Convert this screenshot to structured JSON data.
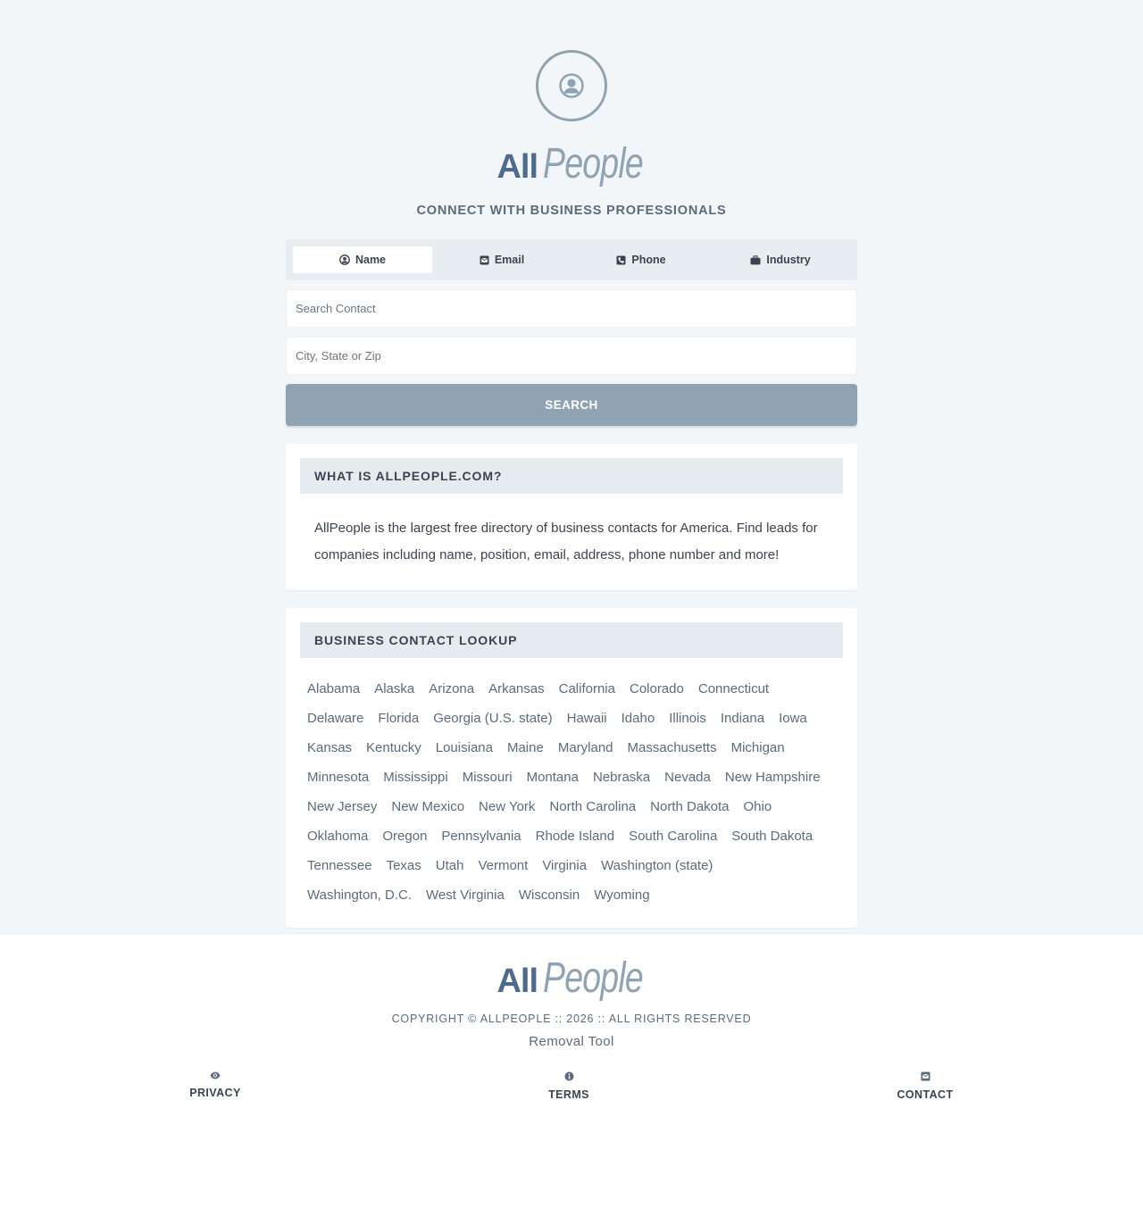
{
  "brand": {
    "logo_all": "All",
    "logo_people": "People"
  },
  "tagline": "CONNECT WITH BUSINESS PROFESSIONALS",
  "tabs": [
    {
      "label": "Name",
      "icon": "user-circle-icon",
      "active": true
    },
    {
      "label": "Email",
      "icon": "envelope-icon",
      "active": false
    },
    {
      "label": "Phone",
      "icon": "phone-icon",
      "active": false
    },
    {
      "label": "Industry",
      "icon": "briefcase-icon",
      "active": false
    }
  ],
  "search": {
    "contact_placeholder": "Search Contact",
    "location_placeholder": "City, State or Zip",
    "button_label": "SEARCH"
  },
  "about": {
    "heading": "WHAT IS ALLPEOPLE.COM?",
    "text": "AllPeople is the largest free directory of business contacts for America. Find leads for companies including name, position, email, address, phone number and more!"
  },
  "lookup": {
    "heading": "BUSINESS CONTACT LOOKUP",
    "states": [
      "Alabama",
      "Alaska",
      "Arizona",
      "Arkansas",
      "California",
      "Colorado",
      "Connecticut",
      "Delaware",
      "Florida",
      "Georgia (U.S. state)",
      "Hawaii",
      "Idaho",
      "Illinois",
      "Indiana",
      "Iowa",
      "Kansas",
      "Kentucky",
      "Louisiana",
      "Maine",
      "Maryland",
      "Massachusetts",
      "Michigan",
      "Minnesota",
      "Mississippi",
      "Missouri",
      "Montana",
      "Nebraska",
      "Nevada",
      "New Hampshire",
      "New Jersey",
      "New Mexico",
      "New York",
      "North Carolina",
      "North Dakota",
      "Ohio",
      "Oklahoma",
      "Oregon",
      "Pennsylvania",
      "Rhode Island",
      "South Carolina",
      "South Dakota",
      "Tennessee",
      "Texas",
      "Utah",
      "Vermont",
      "Virginia",
      "Washington (state)",
      "Washington, D.C.",
      "West Virginia",
      "Wisconsin",
      "Wyoming"
    ]
  },
  "footer": {
    "copyright": "COPYRIGHT © ALLPEOPLE :: 2026 :: ALL RIGHTS RESERVED",
    "removal_tool": "Removal Tool",
    "links": [
      {
        "label": "PRIVACY",
        "icon": "eye-icon"
      },
      {
        "label": "TERMS",
        "icon": "info-icon"
      },
      {
        "label": "CONTACT",
        "icon": "envelope-icon"
      }
    ]
  },
  "colors": {
    "background": "#f3f6f9",
    "accent": "#8fa3b3",
    "brand_dark": "#4e6b8d",
    "text": "#3a4451"
  }
}
